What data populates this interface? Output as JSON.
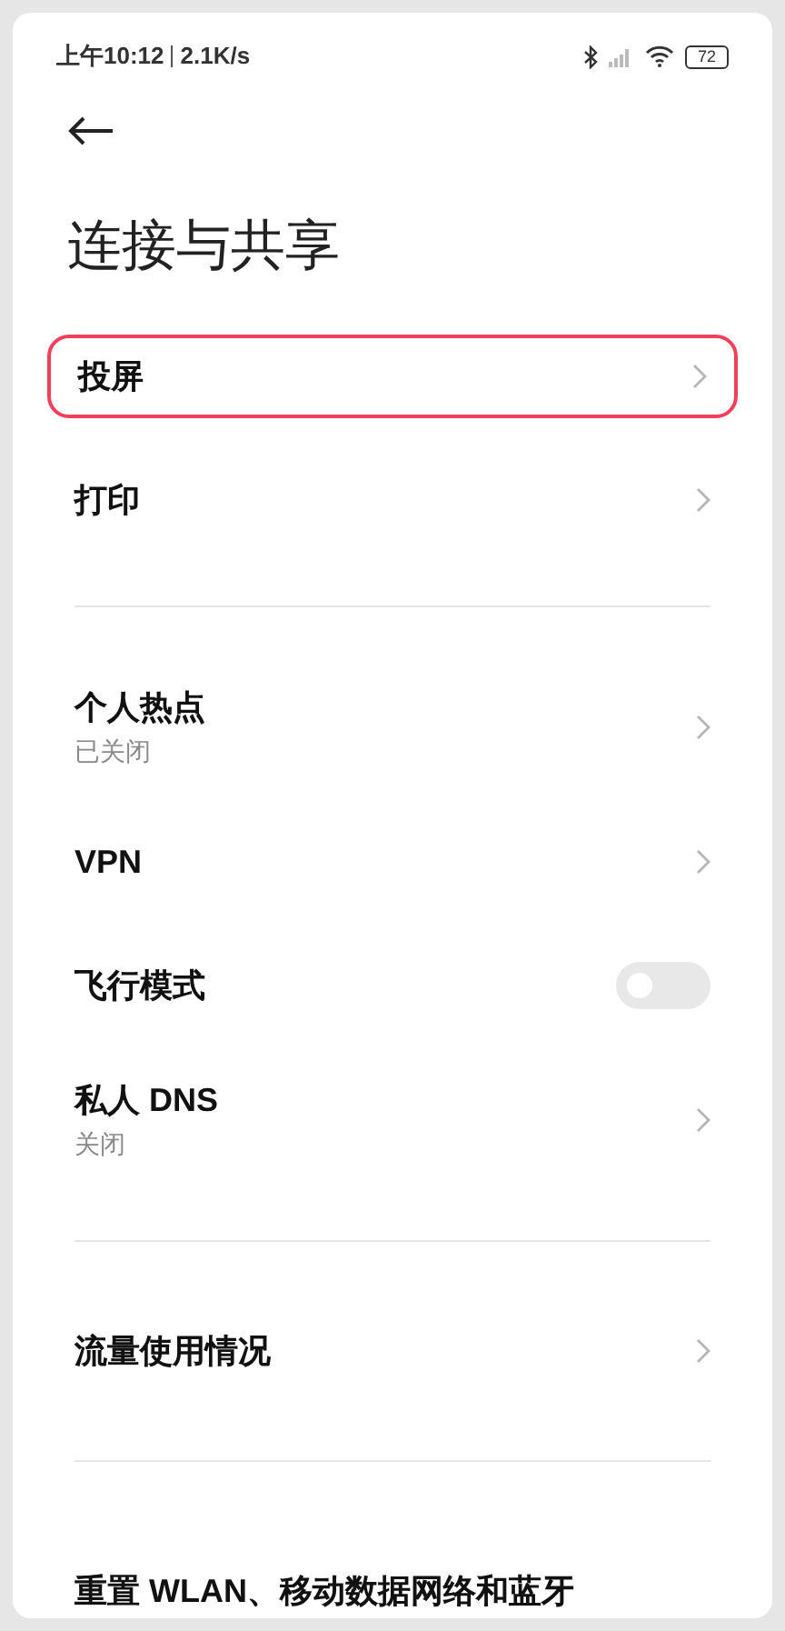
{
  "status_bar": {
    "time": "上午10:12",
    "speed": "2.1K/s",
    "battery": "72"
  },
  "title": "连接与共享",
  "sections": [
    {
      "items": [
        {
          "kind": "link",
          "label": "投屏",
          "highlighted": true
        },
        {
          "kind": "link",
          "label": "打印",
          "highlighted": false
        }
      ]
    },
    {
      "items": [
        {
          "kind": "link",
          "label": "个人热点",
          "subtitle": "已关闭",
          "highlighted": false
        },
        {
          "kind": "link",
          "label": "VPN",
          "highlighted": false
        },
        {
          "kind": "toggle",
          "label": "飞行模式",
          "on": false,
          "highlighted": false
        },
        {
          "kind": "link",
          "label": "私人 DNS",
          "subtitle": "关闭",
          "highlighted": false
        }
      ]
    },
    {
      "items": [
        {
          "kind": "link",
          "label": "流量使用情况",
          "highlighted": false
        }
      ]
    },
    {
      "items": [
        {
          "kind": "cut",
          "label": "重置 WLAN、移动数据网络和蓝牙",
          "highlighted": false
        }
      ]
    }
  ]
}
